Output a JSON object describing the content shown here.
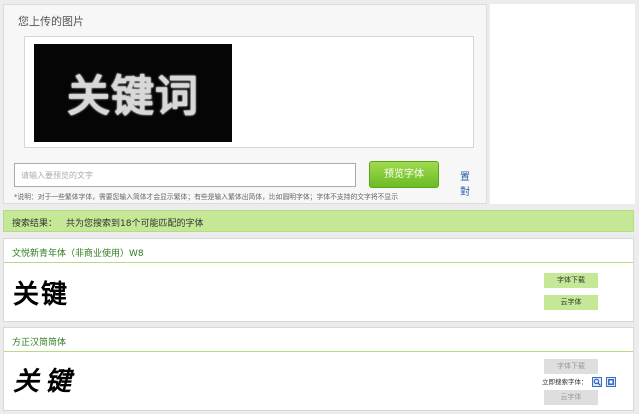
{
  "upload": {
    "title": "您上传的图片",
    "image_text": "关键词",
    "search_placeholder": "请输入要预览的文字",
    "preview_button": "预览字体",
    "compare_link": "置 對",
    "note": "*说明：对于一些繁体字体，需要您输入简体才会显示繁体；有些是输入繁体出简体，比如圆明字体；字体不支持的文字将不显示"
  },
  "results": {
    "label": "搜索结果：",
    "count_text": "共为您搜索到18个可能匹配的字体"
  },
  "fonts": [
    {
      "name": "文悦新青年体（非商业使用）W8",
      "sample": "关键",
      "download_label": "字体下载",
      "cloud_label": "云字体"
    },
    {
      "name": "方正汉简简体",
      "sample": "关键",
      "download_label": "字体下载",
      "search_label": "立即搜索字体：",
      "cloud_label": "云字体"
    }
  ],
  "colors": {
    "accent_green": "#c4e896",
    "title_green": "#2e7d1f",
    "link_blue": "#2a5db0"
  }
}
